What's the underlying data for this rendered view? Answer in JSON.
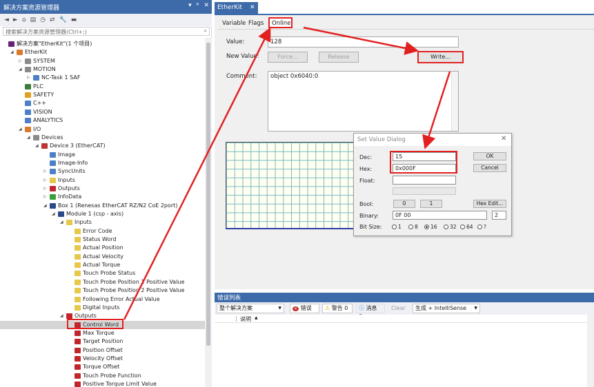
{
  "solution_explorer": {
    "title": "解决方案资源管理器",
    "title_buttons": [
      "▾",
      "ᵖ",
      "✕"
    ],
    "search_placeholder": "搜索解决方案资源管理器(Ctrl+;)",
    "tree": [
      {
        "label": "解决方案\"EtherKit\"(1 个项目)",
        "level": 0,
        "toggle": "",
        "icon": "solution-icon",
        "color": "#68217a"
      },
      {
        "label": "EtherKit",
        "level": 1,
        "toggle": "◢",
        "icon": "project-icon",
        "color": "#d97a2b"
      },
      {
        "label": "SYSTEM",
        "level": 2,
        "toggle": "▷",
        "icon": "system-icon",
        "color": "#8a8a8a"
      },
      {
        "label": "MOTION",
        "level": 2,
        "toggle": "◢",
        "icon": "motion-icon",
        "color": "#8a8a8a"
      },
      {
        "label": "NC-Task 1 SAF",
        "level": 3,
        "toggle": "▷",
        "icon": "nc-task-icon",
        "color": "#4c7fc5"
      },
      {
        "label": "PLC",
        "level": 2,
        "toggle": "",
        "icon": "plc-icon",
        "color": "#3b7d3b"
      },
      {
        "label": "SAFETY",
        "level": 2,
        "toggle": "",
        "icon": "safety-icon",
        "color": "#e0a020"
      },
      {
        "label": "C++",
        "level": 2,
        "toggle": "",
        "icon": "cpp-icon",
        "color": "#4c7fc5"
      },
      {
        "label": "VISION",
        "level": 2,
        "toggle": "",
        "icon": "vision-icon",
        "color": "#4c7fc5"
      },
      {
        "label": "ANALYTICS",
        "level": 2,
        "toggle": "",
        "icon": "analytics-icon",
        "color": "#4c7fc5"
      },
      {
        "label": "I/O",
        "level": 2,
        "toggle": "◢",
        "icon": "io-icon",
        "color": "#d97a2b"
      },
      {
        "label": "Devices",
        "level": 3,
        "toggle": "◢",
        "icon": "devices-icon",
        "color": "#8a8a8a"
      },
      {
        "label": "Device 3 (EtherCAT)",
        "level": 4,
        "toggle": "◢",
        "icon": "ethercat-device-icon",
        "color": "#b33"
      },
      {
        "label": "Image",
        "level": 5,
        "toggle": "",
        "icon": "image-icon",
        "color": "#4c7fc5"
      },
      {
        "label": "Image-Info",
        "level": 5,
        "toggle": "",
        "icon": "image-info-icon",
        "color": "#4c7fc5"
      },
      {
        "label": "SyncUnits",
        "level": 5,
        "toggle": "▷",
        "icon": "syncunits-icon",
        "color": "#4c7fc5"
      },
      {
        "label": "Inputs",
        "level": 5,
        "toggle": "▷",
        "icon": "inputs-folder-icon",
        "color": "#e6c84a"
      },
      {
        "label": "Outputs",
        "level": 5,
        "toggle": "▷",
        "icon": "outputs-folder-icon",
        "color": "#c0262c"
      },
      {
        "label": "InfoData",
        "level": 5,
        "toggle": "▷",
        "icon": "infodata-icon",
        "color": "#3b9d3b"
      },
      {
        "label": "Box 1 (Renesas EtherCAT RZ/N2 CoE 2port)",
        "level": 5,
        "toggle": "◢",
        "icon": "box-icon",
        "color": "#2c4a8a"
      },
      {
        "label": "Module 1 (csp - axis)",
        "level": 6,
        "toggle": "◢",
        "icon": "module-icon",
        "color": "#2c4a8a"
      },
      {
        "label": "Inputs",
        "level": 7,
        "toggle": "◢",
        "icon": "inputs-folder-icon",
        "color": "#e6c84a"
      },
      {
        "label": "Error Code",
        "level": 8,
        "toggle": "",
        "icon": "input-var-icon",
        "color": "#e6c84a"
      },
      {
        "label": "Status Word",
        "level": 8,
        "toggle": "",
        "icon": "input-var-icon",
        "color": "#e6c84a"
      },
      {
        "label": "Actual Position",
        "level": 8,
        "toggle": "",
        "icon": "input-var-icon",
        "color": "#e6c84a"
      },
      {
        "label": "Actual Velocity",
        "level": 8,
        "toggle": "",
        "icon": "input-var-icon",
        "color": "#e6c84a"
      },
      {
        "label": "Actual Torque",
        "level": 8,
        "toggle": "",
        "icon": "input-var-icon",
        "color": "#e6c84a"
      },
      {
        "label": "Touch Probe Status",
        "level": 8,
        "toggle": "",
        "icon": "input-var-icon",
        "color": "#e6c84a"
      },
      {
        "label": "Touch Probe Position 1 Positive Value",
        "level": 8,
        "toggle": "",
        "icon": "input-var-icon",
        "color": "#e6c84a"
      },
      {
        "label": "Touch Probe Position 2 Positive Value",
        "level": 8,
        "toggle": "",
        "icon": "input-var-icon",
        "color": "#e6c84a"
      },
      {
        "label": "Following Error Actual Value",
        "level": 8,
        "toggle": "",
        "icon": "input-var-icon",
        "color": "#e6c84a"
      },
      {
        "label": "Digital Inputs",
        "level": 8,
        "toggle": "",
        "icon": "input-var-icon",
        "color": "#e6c84a"
      },
      {
        "label": "Outputs",
        "level": 7,
        "toggle": "◢",
        "icon": "outputs-folder-icon",
        "color": "#c0262c"
      },
      {
        "label": "Control Word",
        "level": 8,
        "toggle": "",
        "icon": "output-var-icon",
        "color": "#c0262c",
        "selected": true
      },
      {
        "label": "Max Torque",
        "level": 8,
        "toggle": "",
        "icon": "output-var-icon",
        "color": "#c0262c"
      },
      {
        "label": "Target Position",
        "level": 8,
        "toggle": "",
        "icon": "output-var-icon",
        "color": "#c0262c"
      },
      {
        "label": "Position Offset",
        "level": 8,
        "toggle": "",
        "icon": "output-var-icon",
        "color": "#c0262c"
      },
      {
        "label": "Velocity Offset",
        "level": 8,
        "toggle": "",
        "icon": "output-var-icon",
        "color": "#c0262c"
      },
      {
        "label": "Torque Offset",
        "level": 8,
        "toggle": "",
        "icon": "output-var-icon",
        "color": "#c0262c"
      },
      {
        "label": "Touch Probe Function",
        "level": 8,
        "toggle": "",
        "icon": "output-var-icon",
        "color": "#c0262c"
      },
      {
        "label": "Positive Torque Limit Value",
        "level": 8,
        "toggle": "",
        "icon": "output-var-icon",
        "color": "#c0262c"
      }
    ]
  },
  "document": {
    "tab_title": "EtherKit",
    "tab_close": "✕",
    "sub_tabs": [
      "Variable",
      "Flags",
      "Online"
    ],
    "value_label": "Value:",
    "value": "128",
    "new_value_label": "New Value:",
    "force_label": "Force...",
    "release_label": "Release",
    "write_label": "Write...",
    "comment_label": "Comment:",
    "comment": "object 0x6040:0"
  },
  "dialog": {
    "title": "Set Value Dialog",
    "close": "✕",
    "dec_label": "Dec:",
    "dec_value": "15",
    "hex_label": "Hex:",
    "hex_value": "0x000F",
    "float_label": "Float:",
    "float_value": "",
    "bool_label": "Bool:",
    "bool_false": "0",
    "bool_true": "1",
    "hex_edit": "Hex Edit...",
    "binary_label": "Binary:",
    "binary_value": "0F 00",
    "binary_size": "2",
    "bitsize_label": "Bit Size:",
    "bitsize_options": [
      "1",
      "8",
      "16",
      "32",
      "64",
      "?"
    ],
    "bitsize_selected": "16",
    "ok": "OK",
    "cancel": "Cancel"
  },
  "error_list": {
    "title": "错误列表",
    "scope": "整个解决方案",
    "errors": "错误 0",
    "warnings": "警告 0",
    "messages": "消息 0",
    "clear": "Clear",
    "build_filter": "生成 + IntelliSense",
    "col_description": "说明"
  },
  "colors": {
    "accent": "#3d6aa9",
    "annotation_red": "#e32020",
    "grid": "#74b7c5"
  }
}
